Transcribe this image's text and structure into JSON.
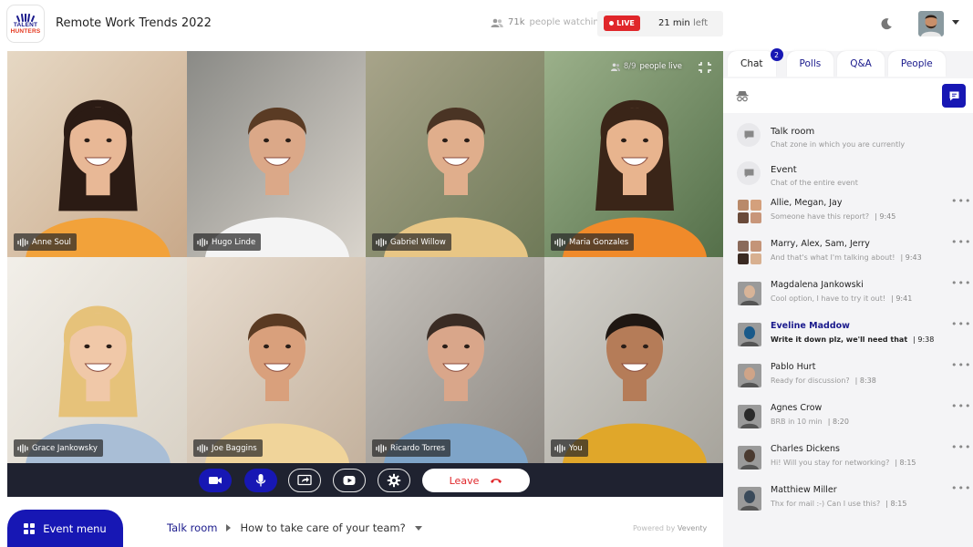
{
  "app": {
    "logo_line1": "TALENT",
    "logo_line2": "HUNTERS",
    "title": "Remote Work Trends 2022"
  },
  "header": {
    "watching_count": "71k",
    "watching_label": "people watching",
    "live_label": "LIVE",
    "time_left_value": "21 min",
    "time_left_unit": "left"
  },
  "stage": {
    "people_live_count": "8/9",
    "people_live_label": "people live",
    "participants": [
      {
        "name": "Anne Soul"
      },
      {
        "name": "Hugo Linde"
      },
      {
        "name": "Gabriel Willow"
      },
      {
        "name": "Maria Gonzales"
      },
      {
        "name": "Grace Jankowsky"
      },
      {
        "name": "Joe Baggins"
      },
      {
        "name": "Ricardo Torres"
      },
      {
        "name": "You"
      }
    ]
  },
  "controls": {
    "leave_label": "Leave"
  },
  "bottom": {
    "event_menu_label": "Event menu",
    "breadcrumb_room": "Talk room",
    "breadcrumb_topic": "How to take care of your team?",
    "powered_prefix": "Powered by",
    "powered_brand": "Veventy"
  },
  "panel": {
    "tabs": [
      {
        "label": "Chat",
        "badge": "2"
      },
      {
        "label": "Polls"
      },
      {
        "label": "Q&A"
      },
      {
        "label": "People"
      }
    ],
    "rooms": [
      {
        "title": "Talk room",
        "subtitle": "Chat zone in which you are currently"
      },
      {
        "title": "Event",
        "subtitle": "Chat of the entire event"
      }
    ],
    "conversations": [
      {
        "name": "Allie, Megan, Jay",
        "message": "Someone have this report?",
        "time": "| 9:45"
      },
      {
        "name": "Marry, Alex, Sam, Jerry",
        "message": "And that's what I'm talking about!",
        "time": "| 9:43"
      },
      {
        "name": "Magdalena Jankowski",
        "message": "Cool option, I have to try it out!",
        "time": "| 9:41"
      },
      {
        "name": "Eveline Maddow",
        "message": "Write it down plz, we'll need that",
        "time": "| 9:38"
      },
      {
        "name": "Pablo Hurt",
        "message": "Ready for discussion?",
        "time": "| 8:38"
      },
      {
        "name": "Agnes Crow",
        "message": "BRB in 10 min",
        "time": "| 8:20"
      },
      {
        "name": "Charles Dickens",
        "message": "Hi! Will you stay for networking?",
        "time": "| 8:15"
      },
      {
        "name": "Matthiew Miller",
        "message": "Thx for mail :-) Can I use this?",
        "time": "| 8:15"
      }
    ],
    "more_label": "•••"
  },
  "colors": {
    "brand_blue": "#1717b4",
    "live_red": "#e0262a",
    "control_bar": "#1f2230"
  }
}
